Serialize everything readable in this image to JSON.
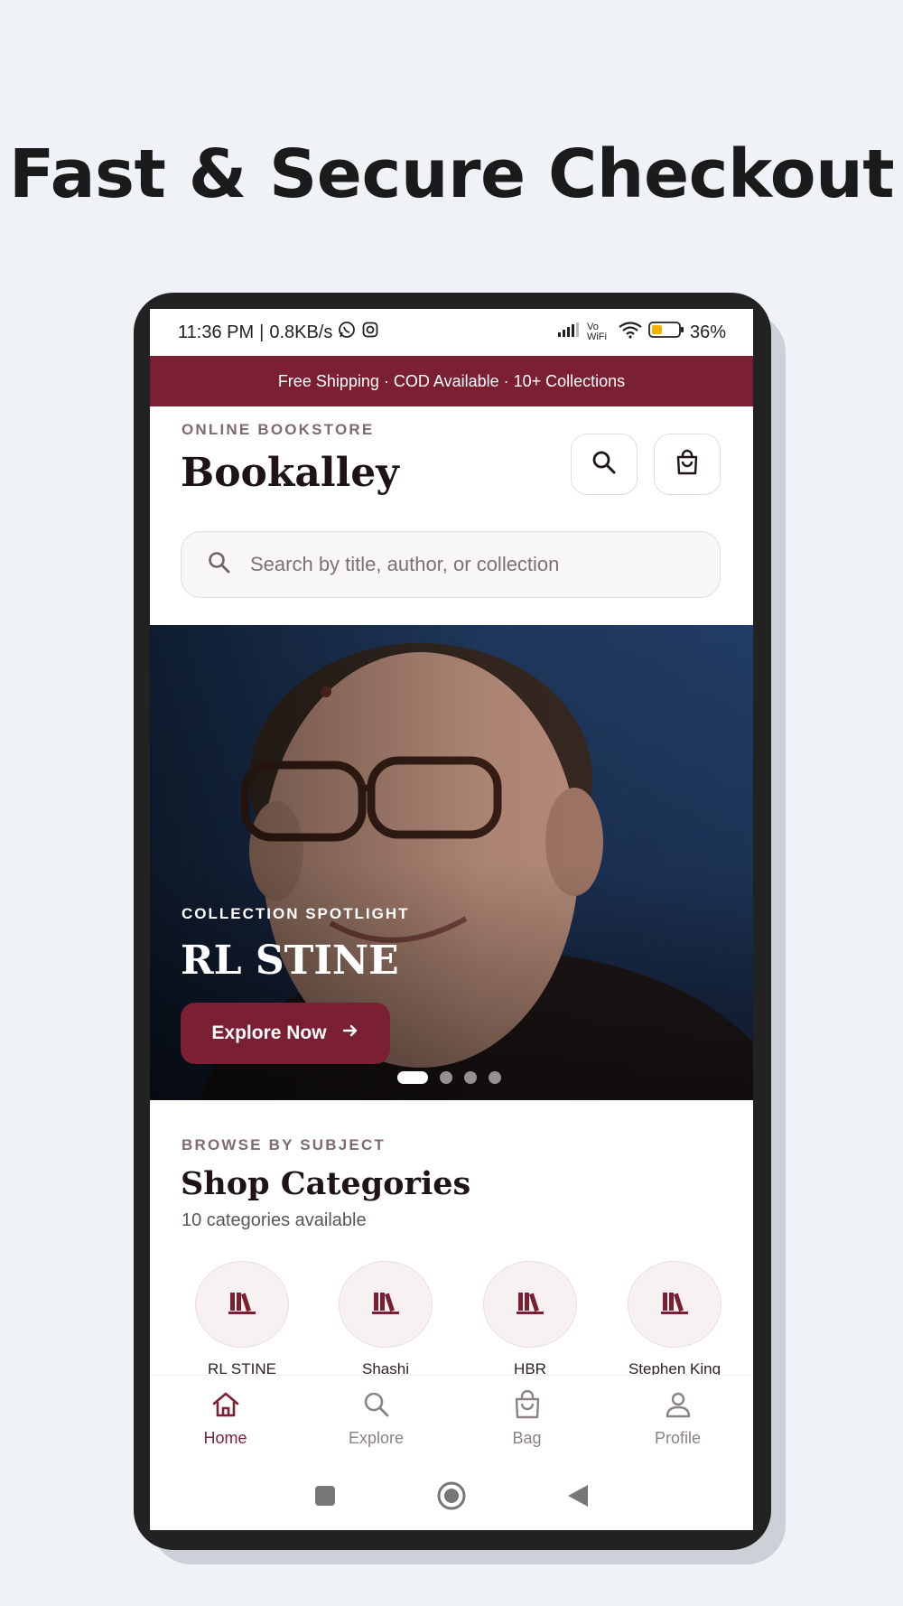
{
  "headline": "Fast & Secure Checkout",
  "status_bar": {
    "time": "11:36 PM",
    "speed": "0.8KB/s",
    "battery": "36%",
    "network_label": "Vo WiFi"
  },
  "promo_banner": "Free Shipping · COD Available · 10+ Collections",
  "header": {
    "overline": "ONLINE BOOKSTORE",
    "brand": "Bookalley"
  },
  "search": {
    "placeholder": "Search by title, author, or collection"
  },
  "hero": {
    "kicker": "COLLECTION SPOTLIGHT",
    "title": "RL STINE",
    "button_label": "Explore Now",
    "slide_count": 4,
    "active_slide": 1
  },
  "categories": {
    "overline": "BROWSE BY SUBJECT",
    "title": "Shop Categories",
    "subtitle": "10 categories available",
    "items": [
      {
        "label": "RL STINE"
      },
      {
        "label": "Shashi"
      },
      {
        "label": "HBR"
      },
      {
        "label": "Stephen King"
      }
    ]
  },
  "bottom_nav": {
    "items": [
      {
        "label": "Home"
      },
      {
        "label": "Explore"
      },
      {
        "label": "Bag"
      },
      {
        "label": "Profile"
      }
    ]
  },
  "colors": {
    "brand": "#7b1f33",
    "background": "#eff2f7"
  }
}
